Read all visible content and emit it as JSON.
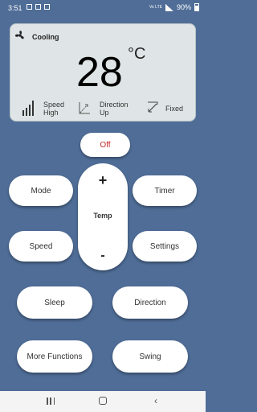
{
  "status_bar": {
    "time": "3:51",
    "network": "Vo LTE",
    "battery": "90%"
  },
  "display": {
    "mode": "Cooling",
    "temperature": "28",
    "unit": "°C",
    "speed_label": "Speed",
    "speed_value": "High",
    "direction_label": "Direction",
    "direction_value": "Up",
    "fixed_label": "Fixed"
  },
  "buttons": {
    "off": "Off",
    "mode": "Mode",
    "timer": "Timer",
    "temp_plus": "+",
    "temp_label": "Temp",
    "temp_minus": "-",
    "speed": "Speed",
    "settings": "Settings",
    "sleep": "Sleep",
    "direction": "Direction",
    "more_functions": "More Functions",
    "swing": "Swing"
  },
  "colors": {
    "background": "#4f6d97",
    "display_bg": "#dfe5e6",
    "off_text": "#c62828"
  },
  "icons": {
    "mode": "fan-icon",
    "speed": "signal-bars-icon",
    "direction": "direction-arrows-icon",
    "fixed": "fixed-louver-icon"
  }
}
